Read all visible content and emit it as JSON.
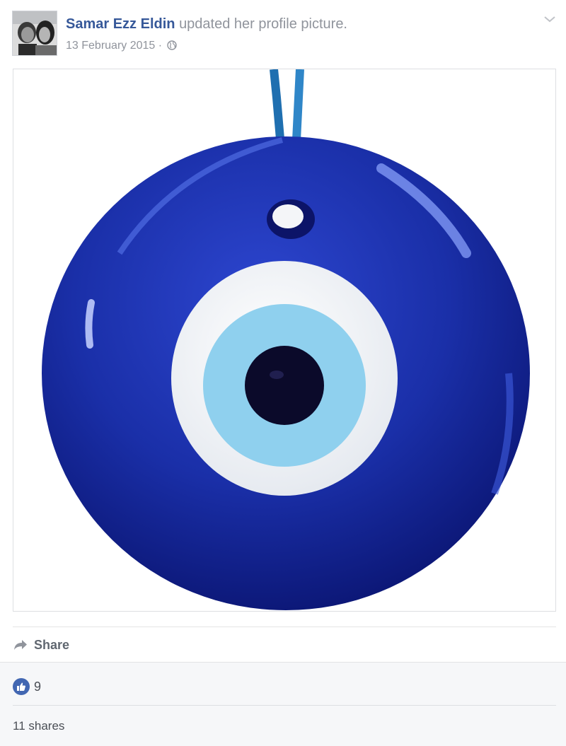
{
  "post": {
    "author": "Samar Ezz Eldin",
    "action": "updated her profile picture.",
    "date": "13 February 2015",
    "separator": "·",
    "privacy_icon": "globe-icon",
    "options_icon": "chevron-down-icon",
    "photo": {
      "subject": "nazar-amulet",
      "colors": {
        "glass": "#1a2fa8",
        "cord": "#2f86c8",
        "white_ring": "#f7f9fb",
        "iris": "#8fd0ee",
        "pupil": "#0b0a2a"
      }
    }
  },
  "actions": {
    "share_label": "Share",
    "share_icon": "share-arrow-icon"
  },
  "stats": {
    "like_icon": "thumbs-up-icon",
    "likes": "9",
    "shares": "11 shares"
  },
  "colors": {
    "link": "#365899",
    "muted": "#90949c",
    "like_blue": "#4267b2",
    "footer_bg": "#f6f7f9"
  }
}
